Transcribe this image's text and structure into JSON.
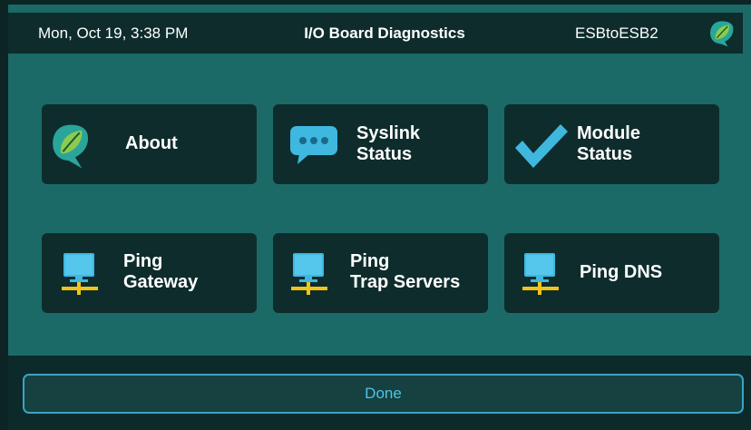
{
  "header": {
    "datetime": "Mon, Oct 19, 3:38 PM",
    "title": "I/O Board Diagnostics",
    "system_name": "ESBtoESB2",
    "logo_icon": "leaf-logo-icon"
  },
  "tiles": [
    {
      "label": "About",
      "icon": "leaf-logo-icon"
    },
    {
      "label": "Syslink\nStatus",
      "icon": "chat-bubble-icon"
    },
    {
      "label": "Module\nStatus",
      "icon": "checkmark-icon"
    },
    {
      "label": "Ping\nGateway",
      "icon": "network-computer-icon"
    },
    {
      "label": "Ping\nTrap Servers",
      "icon": "network-computer-icon"
    },
    {
      "label": "Ping DNS",
      "icon": "network-computer-icon"
    }
  ],
  "footer": {
    "done_label": "Done"
  },
  "colors": {
    "background": "#1b6a67",
    "panel": "#0e2c2c",
    "accent_blue": "#4fc3ea",
    "leaf_green": "#7cc04a",
    "network_yellow": "#f2c417"
  }
}
